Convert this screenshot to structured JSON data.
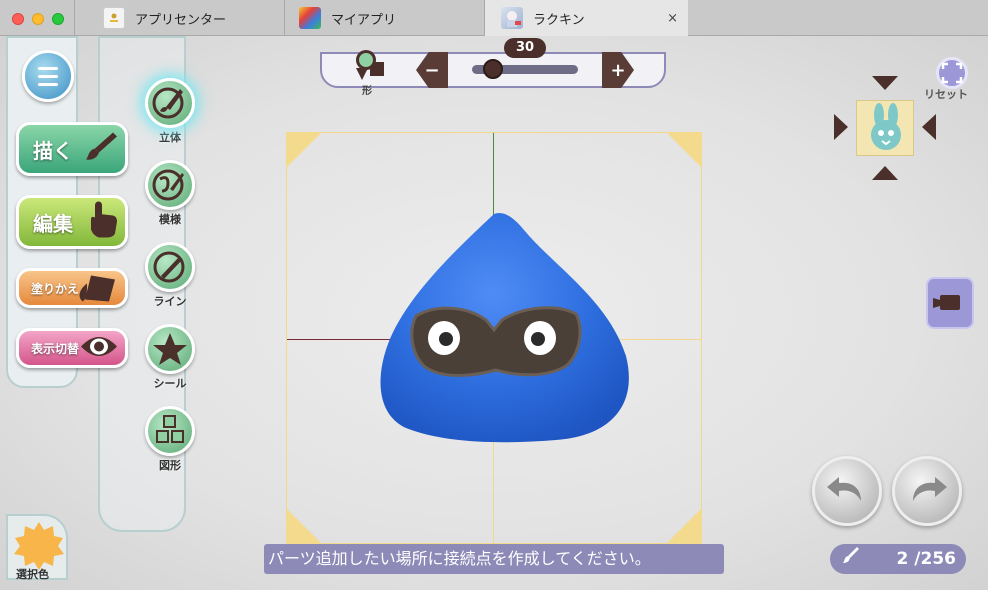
{
  "window": {
    "tabs": [
      {
        "label": "アプリセンター",
        "active": false
      },
      {
        "label": "マイアプリ",
        "active": false
      },
      {
        "label": "ラクキン",
        "active": true
      }
    ],
    "close_glyph": "×"
  },
  "sidebar": {
    "menu_icon": "hamburger-menu-icon",
    "buttons": [
      {
        "label": "描く",
        "icon": "brush-icon"
      },
      {
        "label": "編集",
        "icon": "pointing-hand-icon"
      },
      {
        "label": "塗りかえ",
        "icon": "paint-bucket-icon"
      },
      {
        "label": "表示切替",
        "icon": "eye-icon"
      }
    ]
  },
  "tools": [
    {
      "label": "立体",
      "icon": "3d-brush-icon",
      "active": true
    },
    {
      "label": "模様",
      "icon": "pattern-brush-icon",
      "active": false
    },
    {
      "label": "ライン",
      "icon": "line-icon",
      "active": false
    },
    {
      "label": "シール",
      "icon": "star-sticker-icon",
      "active": false
    },
    {
      "label": "図形",
      "icon": "cubes-icon",
      "active": false
    }
  ],
  "sizebar": {
    "shape_label": "形",
    "minus": "−",
    "plus": "+",
    "value": "30",
    "slider_fraction": 0.2
  },
  "view_nav": {
    "reset_label": "リセット",
    "center_icon": "rabbit-face-icon"
  },
  "status": {
    "hint": "パーツ追加したい場所に接続点を作成してください。",
    "counter": "2 /256"
  },
  "color_picker": {
    "label": "選択色",
    "color": "#f7b54a"
  },
  "colors": {
    "accent": "#8e8ab8",
    "slime": "#2f6fe0",
    "brown": "#4a2f2a"
  }
}
